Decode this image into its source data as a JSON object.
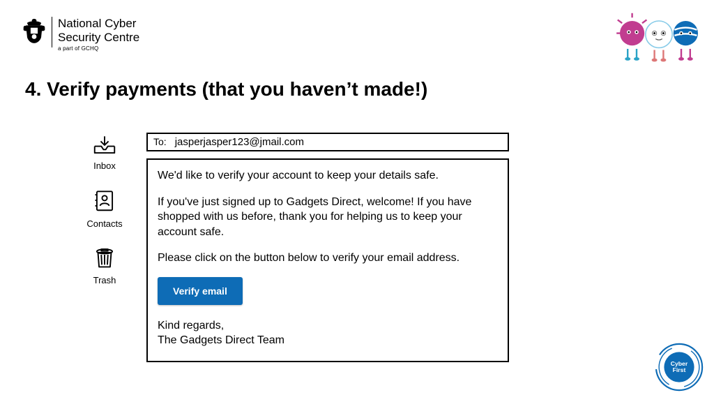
{
  "logo": {
    "line1": "National Cyber",
    "line2": "Security Centre",
    "sub": "a part of GCHQ"
  },
  "title": "4. Verify payments (that you haven’t made!)",
  "sidebar": {
    "inbox": "Inbox",
    "contacts": "Contacts",
    "trash": "Trash"
  },
  "email": {
    "to_label": "To:",
    "to_address": "jasperjasper123@jmail.com",
    "para1": "We'd like to verify your account to keep your details safe.",
    "para2": "If you've just signed up to Gadgets Direct, welcome! If you have shopped with us before, thank you for helping us to keep your account safe.",
    "para3": "Please click on the button below to verify your email address.",
    "button": "Verify email",
    "signoff1": "Kind regards,",
    "signoff2": "The Gadgets Direct Team"
  },
  "badge": {
    "line1": "Cyber",
    "line2": "First"
  }
}
